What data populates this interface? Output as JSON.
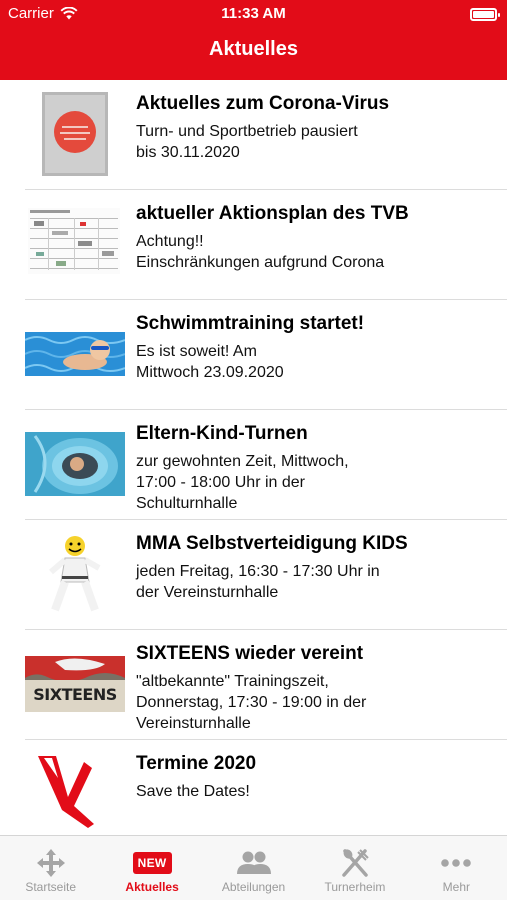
{
  "status_bar": {
    "carrier": "Carrier",
    "time": "11:33 AM"
  },
  "nav": {
    "title": "Aktuelles"
  },
  "items": [
    {
      "title": "Aktuelles zum Corona-Virus",
      "desc": "Turn- und Sportbetrieb pausiert\nbis 30.11.2020",
      "thumb": "corona-sign-icon"
    },
    {
      "title": "aktueller Aktionsplan des TVB",
      "desc": "Achtung!!\nEinschränkungen aufgrund Corona",
      "thumb": "plan-document-icon"
    },
    {
      "title": "Schwimmtraining startet!",
      "desc": "Es ist soweit! Am\nMittwoch 23.09.2020",
      "thumb": "swimming-photo-icon"
    },
    {
      "title": "Eltern-Kind-Turnen",
      "desc": "zur gewohnten Zeit, Mittwoch,\n17:00 - 18:00 Uhr in der\nSchulturnhalle",
      "thumb": "tunnel-photo-icon"
    },
    {
      "title": "MMA Selbstverteidigung KIDS",
      "desc": "jeden Freitag, 16:30 - 17:30 Uhr in\nder Vereinsturnhalle",
      "thumb": "karate-kid-icon"
    },
    {
      "title": "SIXTEENS wieder vereint",
      "desc": "\"altbekannte\" Trainingszeit,\nDonnerstag, 17:30 - 19:00 in der\nVereinsturnhalle",
      "thumb": "sixteens-banner-icon",
      "thumb_text": "SIXTEENS"
    },
    {
      "title": "Termine 2020",
      "desc": "Save the Dates!",
      "thumb": "tvb-logo-icon"
    }
  ],
  "tabs": [
    {
      "label": "Startseite",
      "icon": "home-arrows-icon",
      "active": false
    },
    {
      "label": "Aktuelles",
      "icon": "new-badge-icon",
      "badge": "NEW",
      "active": true
    },
    {
      "label": "Abteilungen",
      "icon": "people-icon",
      "active": false
    },
    {
      "label": "Turnerheim",
      "icon": "fork-knife-icon",
      "active": false
    },
    {
      "label": "Mehr",
      "icon": "more-dots-icon",
      "active": false
    }
  ],
  "colors": {
    "brand_red": "#e20c18",
    "tab_inactive": "#9a9a9a",
    "separator": "#dcdcdc"
  }
}
